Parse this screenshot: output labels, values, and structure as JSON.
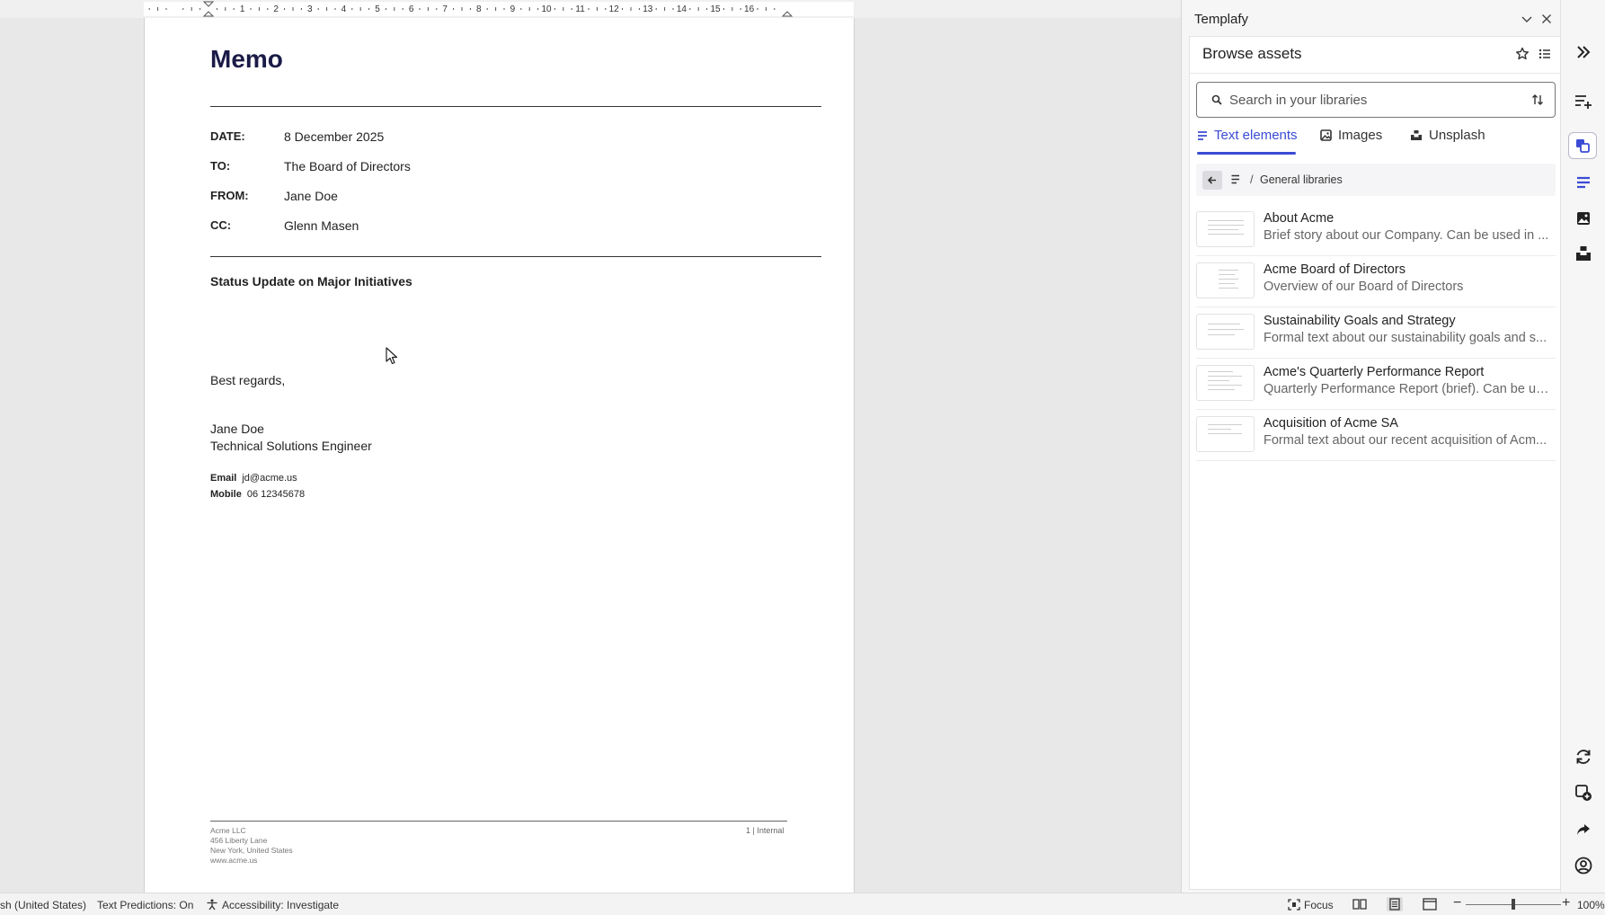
{
  "ruler": {
    "numbers": [
      "1",
      "2",
      "3",
      "4",
      "5",
      "6",
      "7",
      "8",
      "9",
      "10",
      "11",
      "12",
      "13",
      "14",
      "15",
      "16"
    ]
  },
  "memo": {
    "title": "Memo",
    "fields": [
      {
        "label": "DATE:",
        "value": "8 December 2025"
      },
      {
        "label": "TO:",
        "value": "The Board of Directors"
      },
      {
        "label": "FROM:",
        "value": "Jane Doe"
      },
      {
        "label": "CC:",
        "value": "Glenn Masen"
      }
    ],
    "subject": "Status Update on Major Initiatives",
    "closing": "Best regards,",
    "signer_name": "Jane Doe",
    "signer_title": "Technical Solutions Engineer",
    "email_label": "Email",
    "email_value": "jd@acme.us",
    "mobile_label": "Mobile",
    "mobile_value": "06 12345678",
    "footer": {
      "company": "Acme LLC",
      "street": "456 Liberty Lane",
      "city": "New York, United States",
      "web": "www.acme.us",
      "page_label": "1 | Internal"
    }
  },
  "statusbar": {
    "language": "sh (United States)",
    "predictions": "Text Predictions: On",
    "accessibility": "Accessibility: Investigate",
    "focus": "Focus",
    "zoom": "100%",
    "zoom_level": 1.0
  },
  "pane": {
    "title": "Templafy",
    "browse_title": "Browse assets",
    "search_placeholder": "Search in your libraries",
    "tabs": [
      {
        "label": "Text elements",
        "active": true,
        "icon": "text-lines-icon"
      },
      {
        "label": "Images",
        "active": false,
        "icon": "image-icon"
      },
      {
        "label": "Unsplash",
        "active": false,
        "icon": "unsplash-icon"
      }
    ],
    "breadcrumb": {
      "separator": "/",
      "label": "General libraries"
    },
    "assets": [
      {
        "title": "About Acme",
        "desc": "Brief story about our Company. Can be used in ..."
      },
      {
        "title": "Acme Board of Directors",
        "desc": "Overview of our Board of Directors"
      },
      {
        "title": "Sustainability Goals and Strategy",
        "desc": "Formal text about our sustainability goals and s..."
      },
      {
        "title": "Acme's Quarterly Performance Report",
        "desc": "Quarterly Performance Report (brief). Can be us..."
      },
      {
        "title": "Acquisition of Acme SA",
        "desc": "Formal text about our recent acquisition of Acm..."
      }
    ]
  },
  "colors": {
    "accent": "#3a4bd4",
    "memo_title": "#1b1b48"
  }
}
